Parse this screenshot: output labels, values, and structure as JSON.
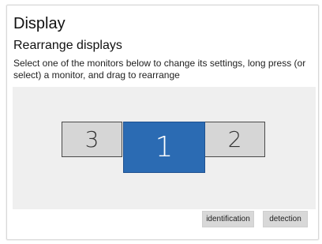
{
  "page": {
    "title": "Display",
    "subtitle": "Rearrange displays",
    "description": "Select one of the monitors below to change its settings, long press (or select) a monitor, and drag to rearrange"
  },
  "monitors": [
    {
      "label": "3",
      "selected": false
    },
    {
      "label": "1",
      "selected": true
    },
    {
      "label": "2",
      "selected": false
    }
  ],
  "buttons": {
    "identify": "identification",
    "detect": "detection"
  },
  "colors": {
    "selected_monitor": "#2b6bb3",
    "unselected_monitor": "#d6d6d6",
    "canvas_background": "#efefef",
    "button_background": "#d8d8d8"
  }
}
